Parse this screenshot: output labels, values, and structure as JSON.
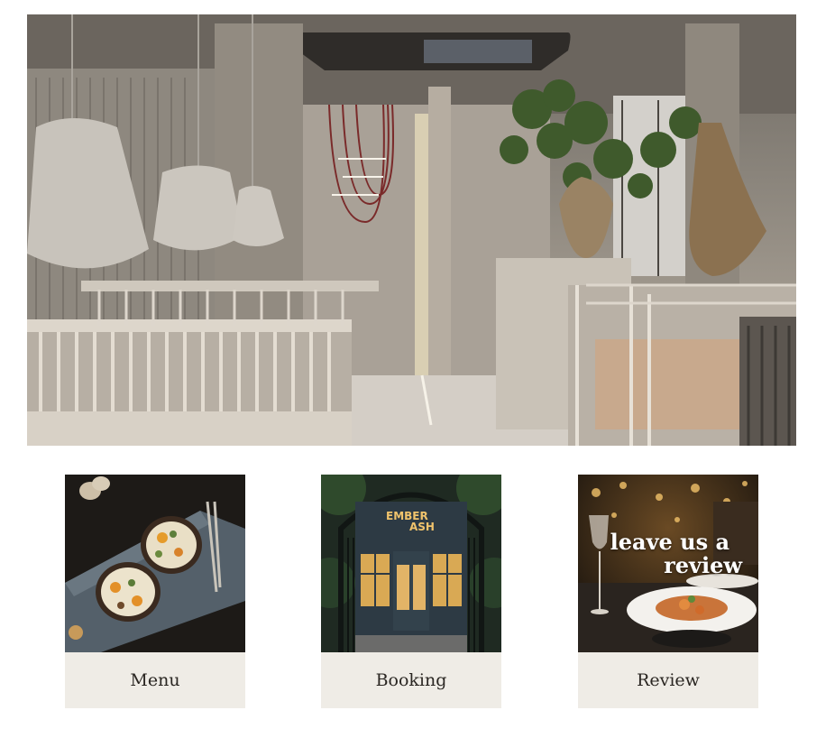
{
  "hero": {
    "image": "restaurant-interior-photo"
  },
  "cards": [
    {
      "id": "menu",
      "label": "Menu",
      "image": "egg-dishes-photo"
    },
    {
      "id": "booking",
      "label": "Booking",
      "image": "restaurant-storefront-photo",
      "sign_line1": "EMBER",
      "sign_line2": "ASH"
    },
    {
      "id": "review",
      "label": "Review",
      "image": "plated-dish-photo",
      "overlay_line1": "leave us a",
      "overlay_line2": "review"
    }
  ],
  "colors": {
    "label_bg": "#efece6",
    "label_text": "#2a2622",
    "sign_gold": "#f0c36c"
  }
}
